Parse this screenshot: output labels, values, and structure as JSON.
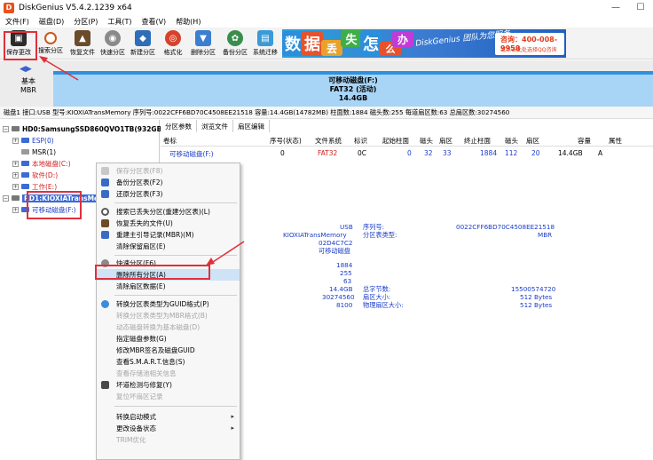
{
  "window": {
    "title": "DiskGenius V5.4.2.1239 x64",
    "app_icon_letter": "D"
  },
  "menu": [
    "文件(F)",
    "磁盘(D)",
    "分区(P)",
    "工具(T)",
    "查看(V)",
    "帮助(H)"
  ],
  "toolbar": [
    {
      "label": "保存更改",
      "icon": "save-icon",
      "color": "#2b2b2b"
    },
    {
      "label": "搜索分区",
      "icon": "search-icon",
      "color": "#c85a1e"
    },
    {
      "label": "恢复文件",
      "icon": "restore-icon",
      "color": "#6a4b2a"
    },
    {
      "label": "快速分区",
      "icon": "quick-partition-icon",
      "color": "#7a7a7a"
    },
    {
      "label": "新建分区",
      "icon": "new-partition-icon",
      "color": "#2f6db8"
    },
    {
      "label": "格式化",
      "icon": "format-icon",
      "color": "#d6422c"
    },
    {
      "label": "删除分区",
      "icon": "delete-icon",
      "color": "#3c7fd0"
    },
    {
      "label": "备份分区",
      "icon": "backup-icon",
      "color": "#3a8d4c"
    },
    {
      "label": "系统迁移",
      "icon": "migrate-icon",
      "color": "#3b9bd8"
    }
  ],
  "banner": {
    "chars": [
      "数",
      "据",
      "丢",
      "失",
      "怎",
      "么",
      "办"
    ],
    "char_colors": [
      "#2b8fdc",
      "#e8522b",
      "#e8a22b",
      "#3fae4a",
      "#2b8fdc",
      "#e8522b",
      "#c13bd6"
    ],
    "slogan": "DiskGenius 团队为您服务",
    "phone": "咨询：400-008-9958",
    "sub": "或点击此处选择QQ咨询"
  },
  "diskmap": {
    "nav_arrows": "◀▶",
    "disk_type": "基本",
    "disk_scheme": "MBR",
    "partition_name": "可移动磁盘(F:)",
    "partition_fs": "FAT32 (活动)",
    "partition_size": "14.4GB"
  },
  "disk_info": "磁盘1 接口:USB  型号:KIOXIATransMemory  序列号:0022CFF6BD70C4508EE21518  容量:14.4GB(14782MB)  柱面数:1884  磁头数:255  每道扇区数:63  总扇区数:30274560",
  "tree": {
    "hd0": "HD0:SamsungSSD860QVO1TB(932GB",
    "esp": "ESP(0)",
    "msr": "MSR(1)",
    "local": "本地磁盘(C:)",
    "soft": "软件(D:)",
    "work": "工作(E:)",
    "rd1": "RD1:KIOXIATransMem",
    "removable": "可移动磁盘(F:)"
  },
  "tabs": [
    "分区参数",
    "浏览文件",
    "扇区编辑"
  ],
  "grid": {
    "headers": [
      "卷标",
      "序号(状态)",
      "文件系统",
      "标识",
      "起始柱面",
      "磁头",
      "扇区",
      "终止柱面",
      "磁头",
      "扇区",
      "容量",
      "属性"
    ],
    "row": [
      "可移动磁盘(F:)",
      "0",
      "FAT32",
      "0C",
      "0",
      "32",
      "33",
      "1884",
      "112",
      "20",
      "14.4GB",
      "A"
    ]
  },
  "details": {
    "iface": "USB",
    "model": "KIOXIATransMemory",
    "model_id": "02D4C7C2",
    "model_type": "可移动磁盘",
    "serial_label": "序列号:",
    "serial": "0022CFF6BD70C4508EE21518",
    "ptype_label": "分区表类型:",
    "ptype": "MBR",
    "cyl": "1884",
    "heads": "255",
    "spt": "63",
    "cap": "14.4GB",
    "total_sec": "30274560",
    "misc": "8100",
    "bytes_label": "总字节数:",
    "bytes": "15500574720",
    "sector_size_label": "扇区大小:",
    "sector_size": "512 Bytes",
    "phys_label": "物理扇区大小:",
    "phys": "512 Bytes"
  },
  "context_menu": [
    {
      "label": "保存分区表(F8)",
      "disabled": true,
      "icon": "save-table-icon",
      "color": "#bbbbbb"
    },
    {
      "label": "备份分区表(F2)",
      "disabled": false,
      "icon": "backup-table-icon",
      "color": "#3a6bc4"
    },
    {
      "label": "还原分区表(F3)",
      "disabled": false,
      "icon": "restore-table-icon",
      "color": "#3a6bc4"
    },
    {
      "label": "搜索已丢失分区(重建分区表)(L)",
      "disabled": false,
      "icon": "search-lost-icon",
      "color": "#5a5a5a"
    },
    {
      "label": "恢复丢失的文件(U)",
      "disabled": false,
      "icon": "recover-files-icon",
      "color": "#6a4b2a"
    },
    {
      "label": "重建主引导记录(MBR)(M)",
      "disabled": false,
      "icon": "rebuild-mbr-icon",
      "color": "#3a6bc4"
    },
    {
      "label": "清除保留扇区(E)",
      "disabled": false,
      "icon": "",
      "color": ""
    },
    {
      "label": "快速分区(F6)",
      "disabled": false,
      "icon": "quick-partition-icon",
      "color": "#7a7a7a"
    },
    {
      "label": "删除所有分区(A)",
      "disabled": false,
      "icon": "",
      "color": "",
      "highlight": true
    },
    {
      "label": "清除扇区数据(E)",
      "disabled": false,
      "icon": "",
      "color": ""
    },
    {
      "label": "转换分区表类型为GUID格式(P)",
      "disabled": false,
      "icon": "convert-guid-icon",
      "color": "#3a8dd8"
    },
    {
      "label": "转换分区表类型为MBR格式(B)",
      "disabled": true,
      "icon": "",
      "color": ""
    },
    {
      "label": "动态磁盘转换为基本磁盘(D)",
      "disabled": true,
      "icon": "",
      "color": ""
    },
    {
      "label": "指定磁盘参数(G)",
      "disabled": false,
      "icon": "",
      "color": ""
    },
    {
      "label": "修改MBR签名及磁盘GUID",
      "disabled": false,
      "icon": "",
      "color": ""
    },
    {
      "label": "查看S.M.A.R.T.信息(S)",
      "disabled": false,
      "icon": "",
      "color": ""
    },
    {
      "label": "查看存储池相关信息",
      "disabled": true,
      "icon": "",
      "color": ""
    },
    {
      "label": "坏道检测与修复(Y)",
      "disabled": false,
      "icon": "repair-tools-icon",
      "color": "#4a4a4a"
    },
    {
      "label": "复位坏扇区记录",
      "disabled": true,
      "icon": "",
      "color": ""
    },
    {
      "label": "转换启动模式",
      "disabled": false,
      "icon": "",
      "color": "",
      "submenu": true
    },
    {
      "label": "更改设备状态",
      "disabled": false,
      "icon": "",
      "color": "",
      "submenu": true
    },
    {
      "label": "TRIM优化",
      "disabled": true,
      "icon": "",
      "color": ""
    }
  ]
}
